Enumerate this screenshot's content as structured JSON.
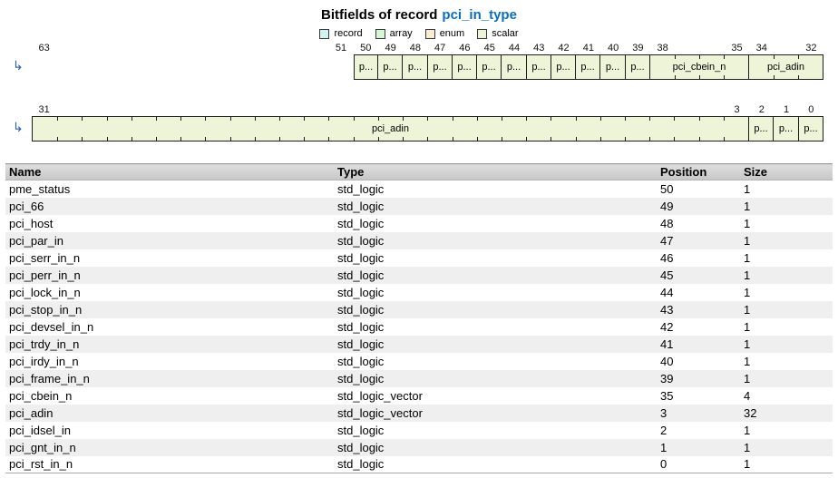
{
  "title": {
    "prefix": "Bitfields of record",
    "record_name": "pci_in_type",
    "record_link_color": "#0a6ebd"
  },
  "legend": {
    "items": [
      {
        "label": "record",
        "color": "#d4f2ee"
      },
      {
        "label": "array",
        "color": "#d7f5d7"
      },
      {
        "label": "enum",
        "color": "#faedd3"
      },
      {
        "label": "scalar",
        "color": "#edf3d6"
      }
    ]
  },
  "diagram": {
    "arrow_icon": "↳",
    "cell_fill": "#edf4d8",
    "rows": [
      {
        "total_bits": 32,
        "gap": {
          "bits": 13,
          "left_num": "63",
          "right_num": "51"
        },
        "cells": [
          {
            "bits": 1,
            "label": "p...",
            "nums": [
              "50"
            ]
          },
          {
            "bits": 1,
            "label": "p...",
            "nums": [
              "49"
            ]
          },
          {
            "bits": 1,
            "label": "p...",
            "nums": [
              "48"
            ]
          },
          {
            "bits": 1,
            "label": "p...",
            "nums": [
              "47"
            ]
          },
          {
            "bits": 1,
            "label": "p...",
            "nums": [
              "46"
            ]
          },
          {
            "bits": 1,
            "label": "p...",
            "nums": [
              "45"
            ]
          },
          {
            "bits": 1,
            "label": "p...",
            "nums": [
              "44"
            ]
          },
          {
            "bits": 1,
            "label": "p...",
            "nums": [
              "43"
            ]
          },
          {
            "bits": 1,
            "label": "p...",
            "nums": [
              "42"
            ]
          },
          {
            "bits": 1,
            "label": "p...",
            "nums": [
              "41"
            ]
          },
          {
            "bits": 1,
            "label": "p...",
            "nums": [
              "40"
            ]
          },
          {
            "bits": 1,
            "label": "p...",
            "nums": [
              "39"
            ]
          },
          {
            "bits": 4,
            "label": "pci_cbein_n",
            "nums": [
              "38",
              "35"
            ]
          },
          {
            "bits": 3,
            "label": "pci_adin",
            "nums": [
              "34",
              "32"
            ]
          }
        ]
      },
      {
        "total_bits": 32,
        "gap": null,
        "cells": [
          {
            "bits": 29,
            "label": "pci_adin",
            "nums": [
              "31",
              "3"
            ]
          },
          {
            "bits": 1,
            "label": "p...",
            "nums": [
              "2"
            ]
          },
          {
            "bits": 1,
            "label": "p...",
            "nums": [
              "1"
            ]
          },
          {
            "bits": 1,
            "label": "p...",
            "nums": [
              "0"
            ]
          }
        ]
      }
    ]
  },
  "table": {
    "columns": [
      "Name",
      "Type",
      "Position",
      "Size"
    ],
    "rows": [
      {
        "name": "pme_status",
        "type": "std_logic",
        "position": "50",
        "size": "1"
      },
      {
        "name": "pci_66",
        "type": "std_logic",
        "position": "49",
        "size": "1"
      },
      {
        "name": "pci_host",
        "type": "std_logic",
        "position": "48",
        "size": "1"
      },
      {
        "name": "pci_par_in",
        "type": "std_logic",
        "position": "47",
        "size": "1"
      },
      {
        "name": "pci_serr_in_n",
        "type": "std_logic",
        "position": "46",
        "size": "1"
      },
      {
        "name": "pci_perr_in_n",
        "type": "std_logic",
        "position": "45",
        "size": "1"
      },
      {
        "name": "pci_lock_in_n",
        "type": "std_logic",
        "position": "44",
        "size": "1"
      },
      {
        "name": "pci_stop_in_n",
        "type": "std_logic",
        "position": "43",
        "size": "1"
      },
      {
        "name": "pci_devsel_in_n",
        "type": "std_logic",
        "position": "42",
        "size": "1"
      },
      {
        "name": "pci_trdy_in_n",
        "type": "std_logic",
        "position": "41",
        "size": "1"
      },
      {
        "name": "pci_irdy_in_n",
        "type": "std_logic",
        "position": "40",
        "size": "1"
      },
      {
        "name": "pci_frame_in_n",
        "type": "std_logic",
        "position": "39",
        "size": "1"
      },
      {
        "name": "pci_cbein_n",
        "type": "std_logic_vector",
        "position": "35",
        "size": "4"
      },
      {
        "name": "pci_adin",
        "type": "std_logic_vector",
        "position": "3",
        "size": "32"
      },
      {
        "name": "pci_idsel_in",
        "type": "std_logic",
        "position": "2",
        "size": "1"
      },
      {
        "name": "pci_gnt_in_n",
        "type": "std_logic",
        "position": "1",
        "size": "1"
      },
      {
        "name": "pci_rst_in_n",
        "type": "std_logic",
        "position": "0",
        "size": "1"
      }
    ]
  }
}
